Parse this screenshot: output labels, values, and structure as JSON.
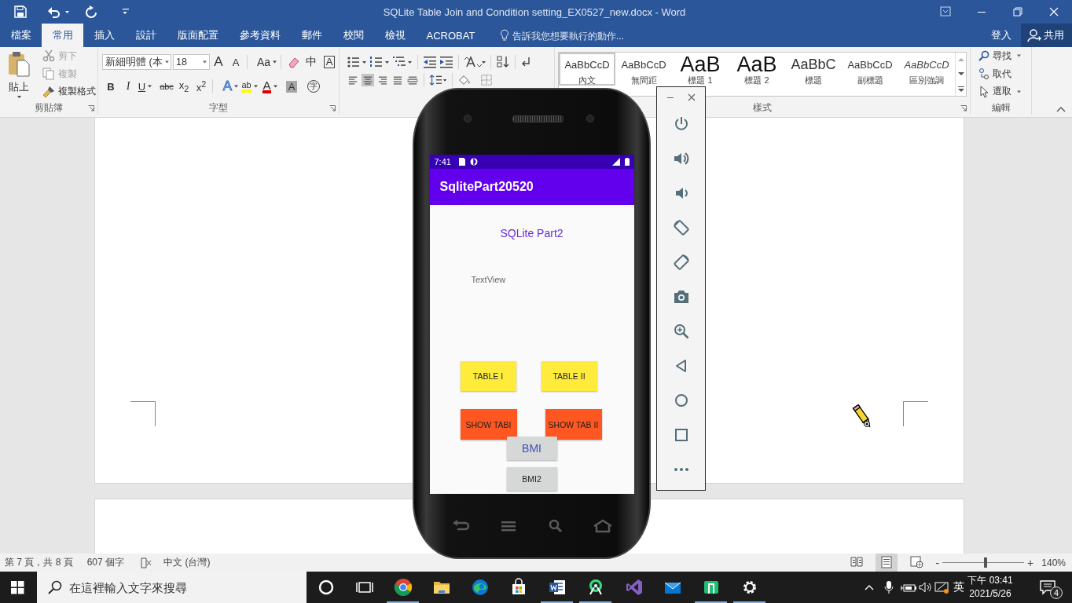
{
  "window": {
    "title": "SQLite Table Join and Condition setting_EX0527_new.docx - Word"
  },
  "tabs": [
    {
      "label": "檔案",
      "selected": false
    },
    {
      "label": "常用",
      "selected": true
    },
    {
      "label": "插入",
      "selected": false
    },
    {
      "label": "設計",
      "selected": false
    },
    {
      "label": "版面配置",
      "selected": false
    },
    {
      "label": "參考資料",
      "selected": false
    },
    {
      "label": "郵件",
      "selected": false
    },
    {
      "label": "校閱",
      "selected": false
    },
    {
      "label": "檢視",
      "selected": false
    },
    {
      "label": "ACROBAT",
      "selected": false
    }
  ],
  "tell_me": {
    "placeholder": "告訴我您想要執行的動作..."
  },
  "account": {
    "sign_in": "登入",
    "share": "共用"
  },
  "clipboard": {
    "paste": "貼上",
    "items": [
      {
        "label": "剪下",
        "disabled": true
      },
      {
        "label": "複製",
        "disabled": true
      },
      {
        "label": "複製格式",
        "disabled": false
      }
    ],
    "label": "剪貼簿"
  },
  "font": {
    "name": "新細明體 (本",
    "size": "18",
    "row1": [
      {
        "label": "A",
        "kind": "grow"
      },
      {
        "label": "A",
        "kind": "shrink"
      },
      {
        "label": "Aa",
        "kind": "case"
      },
      {
        "label": "中",
        "kind": "phonetic"
      },
      {
        "label": "A",
        "kind": "border"
      }
    ],
    "row2": [
      {
        "label": "B",
        "kind": "bold"
      },
      {
        "label": "I",
        "kind": "italic"
      },
      {
        "label": "U",
        "kind": "underline"
      },
      {
        "label": "abc",
        "kind": "strike"
      },
      {
        "label": "x$_{2}$",
        "kind": "sub"
      },
      {
        "label": "x$^{2}$",
        "kind": "super"
      },
      {
        "label": "A",
        "kind": "effect"
      },
      {
        "label": "ab",
        "kind": "highlight"
      },
      {
        "label": "A",
        "kind": "color"
      },
      {
        "label": "A",
        "kind": "shade"
      },
      {
        "label": "字",
        "kind": "enclose"
      }
    ],
    "label": "字型"
  },
  "paragraph": {
    "alignment": [
      {
        "kind": "left",
        "selected": false
      },
      {
        "kind": "center",
        "selected": true
      },
      {
        "kind": "right",
        "selected": false
      },
      {
        "kind": "justify",
        "selected": false
      },
      {
        "kind": "distributed",
        "selected": false
      }
    ]
  },
  "styles": {
    "items": [
      {
        "sample": "AaBbCcD",
        "name": "內文",
        "kind": "normal",
        "selected": true
      },
      {
        "sample": "AaBbCcD",
        "name": "無間距",
        "kind": "normal",
        "selected": false
      },
      {
        "sample": "AaB",
        "name": "標題 1",
        "kind": "heading",
        "selected": false
      },
      {
        "sample": "AaB",
        "name": "標題 2",
        "kind": "heading",
        "selected": false
      },
      {
        "sample": "AaBbC",
        "name": "標題",
        "kind": "title",
        "selected": false
      },
      {
        "sample": "AaBbCcD",
        "name": "副標題",
        "kind": "subtitle",
        "selected": false
      },
      {
        "sample": "AaBbCcD",
        "name": "區別強調",
        "kind": "emphasis",
        "selected": false
      }
    ],
    "label": "樣式"
  },
  "editing": {
    "items": [
      {
        "label": "尋找",
        "kind": "find"
      },
      {
        "label": "取代",
        "kind": "replace"
      },
      {
        "label": "選取",
        "kind": "select"
      }
    ],
    "label": "編輯"
  },
  "emulator": {
    "status_time": "7:41",
    "app_title": "SqlitePart20520",
    "heading": "SQLite Part2",
    "text_view": "TextView",
    "button_rows": [
      [
        {
          "label": "TABLE I",
          "color": "#ffeb3b",
          "kind": "plain"
        },
        {
          "label": "TABLE II",
          "color": "#ffeb3b",
          "kind": "plain"
        }
      ],
      [
        {
          "label": "SHOW TABI",
          "color": "#ff5722",
          "kind": "plain"
        },
        {
          "label": "SHOW TAB II",
          "color": "#ff5722",
          "kind": "plain"
        }
      ],
      [
        {
          "label": "BMI",
          "color": "#d6d7d7",
          "kind": "accent"
        }
      ],
      [
        {
          "label": "BMI2",
          "color": "#d6d7d7",
          "kind": "plain"
        }
      ]
    ]
  },
  "status_bar": {
    "page": "第 7 頁，共 8 頁",
    "words": "607 個字",
    "language": "中文 (台灣)",
    "views": [
      {
        "kind": "read",
        "selected": false
      },
      {
        "kind": "print",
        "selected": true
      },
      {
        "kind": "web",
        "selected": false
      }
    ],
    "zoom_out": "-",
    "zoom": {
      "level": 0.53
    },
    "zoom_in": "+",
    "zoom_text": "140%"
  },
  "taskbar": {
    "search": {
      "placeholder": "在這裡輸入文字來搜尋"
    },
    "apps": [
      {
        "kind": "cortana",
        "running": false
      },
      {
        "kind": "taskview",
        "running": false
      },
      {
        "kind": "chrome",
        "running": true
      },
      {
        "kind": "folder",
        "running": false
      },
      {
        "kind": "edge",
        "running": false
      },
      {
        "kind": "store",
        "running": false
      },
      {
        "kind": "word",
        "running": true
      },
      {
        "kind": "studio",
        "running": true
      },
      {
        "kind": "vs",
        "running": false
      },
      {
        "kind": "mail",
        "running": false
      },
      {
        "kind": "green",
        "running": true
      },
      {
        "kind": "settings",
        "running": true
      }
    ],
    "ime": "英",
    "time": "下午 03:41",
    "date": "2021/5/26",
    "notifications": "4"
  }
}
